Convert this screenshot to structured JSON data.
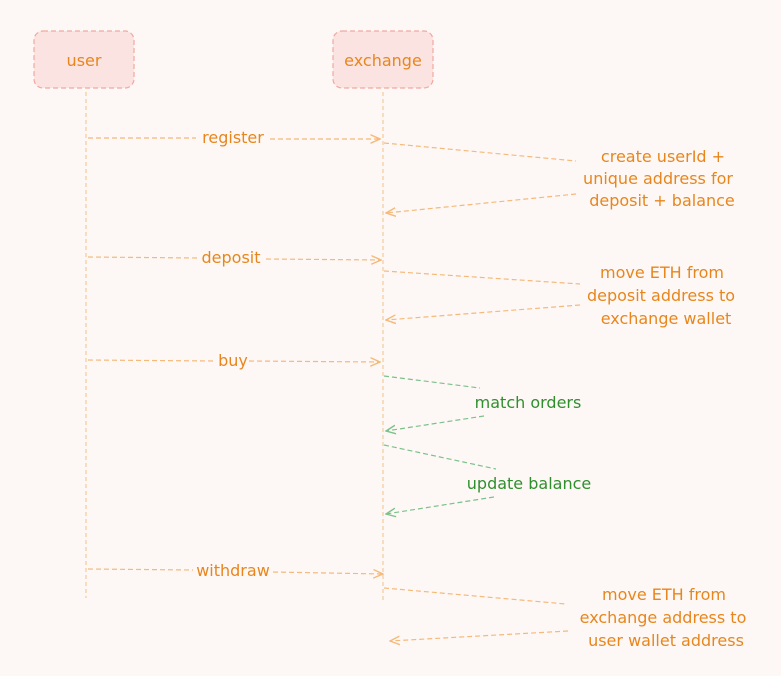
{
  "colors": {
    "background": "#fdf8f5",
    "actor_fill": "#fbe3e1",
    "actor_stroke": "#f2a8a0",
    "lifeline": "#f5c99a",
    "orange": "#e8861d",
    "orange_arrow": "#f5b97a",
    "green": "#2f8f2f",
    "green_arrow": "#7cc18a"
  },
  "actors": {
    "user": "user",
    "exchange": "exchange"
  },
  "messages": {
    "register": "register",
    "deposit": "deposit",
    "buy": "buy",
    "withdraw": "withdraw"
  },
  "notes": {
    "register": [
      "create userId +",
      "unique address for",
      "deposit + balance"
    ],
    "deposit": [
      "move ETH from",
      "deposit address to",
      "exchange wallet"
    ],
    "match": [
      "match orders"
    ],
    "update": [
      "update balance"
    ],
    "withdraw": [
      "move ETH from",
      "exchange address to",
      "user wallet address"
    ]
  }
}
